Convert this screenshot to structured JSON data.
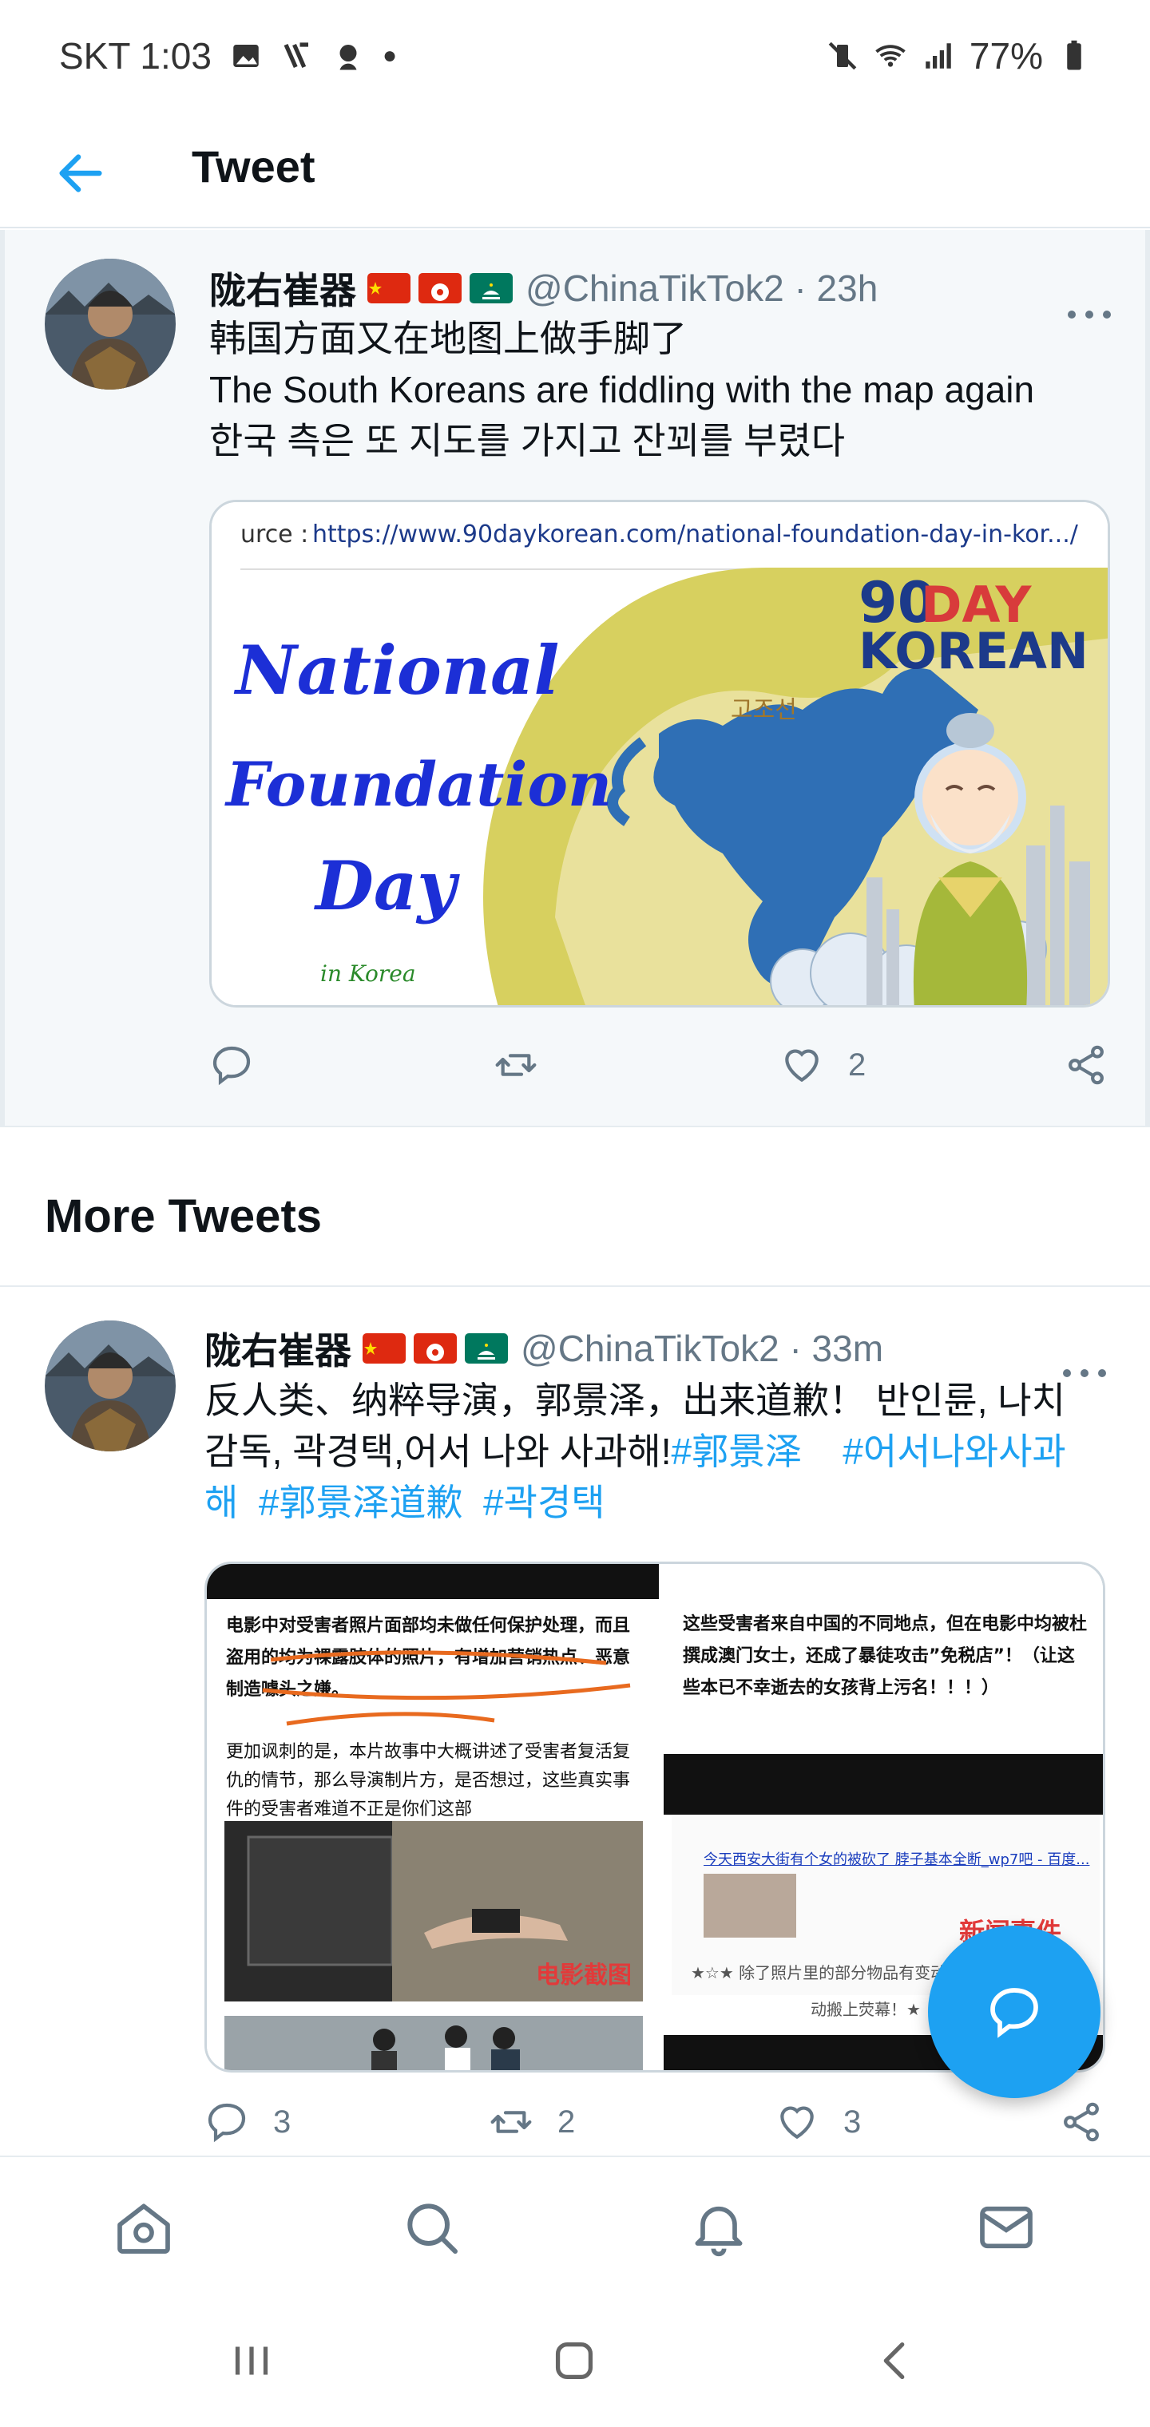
{
  "status_bar": {
    "carrier_time": "SKT 1:03",
    "battery": "77%"
  },
  "header": {
    "title": "Tweet"
  },
  "main_tweet": {
    "author_name": "陇右崔器",
    "handle_time": "@ChinaTikTok2 · 23h",
    "text_line1": "韩国方面又在地图上做手脚了",
    "text_line2": "The South Koreans are fiddling with the map again",
    "text_line3": "한국 측은 또 지도를 가지고 잔꾀를 부렸다",
    "media": {
      "source": "urce : https://www.90daykorean.com/national-foundation-day-in-kor.../",
      "title_line1": "National",
      "title_line2": "Foundation",
      "title_line3": "Day",
      "subtitle": "in Korea",
      "map_label": "고조선",
      "brand_90": "90",
      "brand_day": "DAY",
      "brand_korean": "KOREAN"
    },
    "like_count": "2"
  },
  "more_tweets": {
    "title": "More Tweets"
  },
  "second_tweet": {
    "author_name": "陇右崔器",
    "handle_time": "@ChinaTikTok2 · 33m",
    "text_part1": "反人类、纳粹导演，郭景泽，出来道歉！ 반인륜, 나치",
    "text_part2": "감독, 곽경택,어서 나와 사과해!",
    "hashtag1": "#郭景泽",
    "hashtag2": "#어서나와사과",
    "hashtag2b": "해",
    "hashtag3": "#郭景泽道歉",
    "hashtag4": "#곽경택",
    "media_left": {
      "para1": "电影中对受害者照片面部均未做任何保护处理，而且盗用的均为裸露肢体的照片，有增加营销热点、恶意制造噱头之嫌。",
      "para2": "更加讽刺的是，本片故事中大概讲述了受害者复活复仇的情节，那么导演制片方，是否想过，这些真实事件的受害者难道不正是你们这部",
      "stamp": "电影截图"
    },
    "media_right": {
      "para1": "这些受害者来自中国的不同地点，但在电影中均被杜撰成澳门女士，还成了暴徒攻击”免税店”！（让这些本已不幸逝去的女孩背上污名！！！）",
      "link": "今天西安大街有个女的被砍了 脖子基本全断_wp7吧 - 百度...",
      "stamp": "新闻事件",
      "note": "★☆★ 除了照片里的部分物品有变动",
      "note2": "动搬上荧幕！★"
    },
    "reply_count": "3",
    "retweet_count": "2",
    "like_count": "3"
  },
  "colors": {
    "accent": "#1da1f2",
    "secondary_text": "#657786",
    "primary_text": "#0f1419"
  }
}
